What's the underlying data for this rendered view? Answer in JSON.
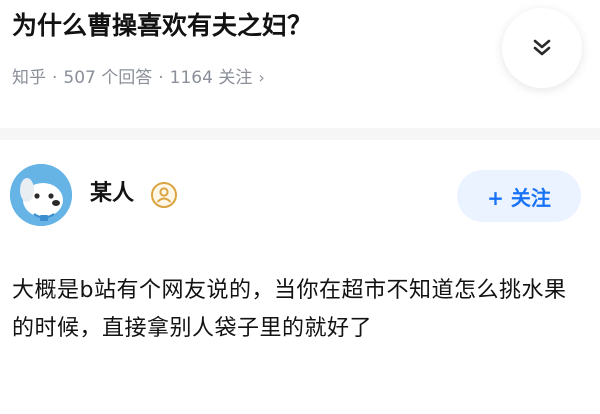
{
  "question": {
    "title": "为什么曹操喜欢有夫之妇？",
    "source": "知乎",
    "separator": "·",
    "answers": "507 个回答",
    "followers": "1164 关注",
    "chevron": "›",
    "collapse_icon": "double-chevron-down-icon"
  },
  "author": {
    "name": "某人",
    "avatar_icon": "dog-avatar-icon",
    "badge_icon": "verified-user-badge-icon",
    "follow_label": "+ 关注"
  },
  "answer": {
    "text": "大概是b站有个网友说的，当你在超市不知道怎么挑水果的时候，直接拿别人袋子里的就好了"
  },
  "colors": {
    "accent": "#1772f6",
    "follow_bg": "#eaf3ff",
    "meta_text": "#8a8f99",
    "title_text": "#121212",
    "avatar_bg": "#66b3e6"
  }
}
